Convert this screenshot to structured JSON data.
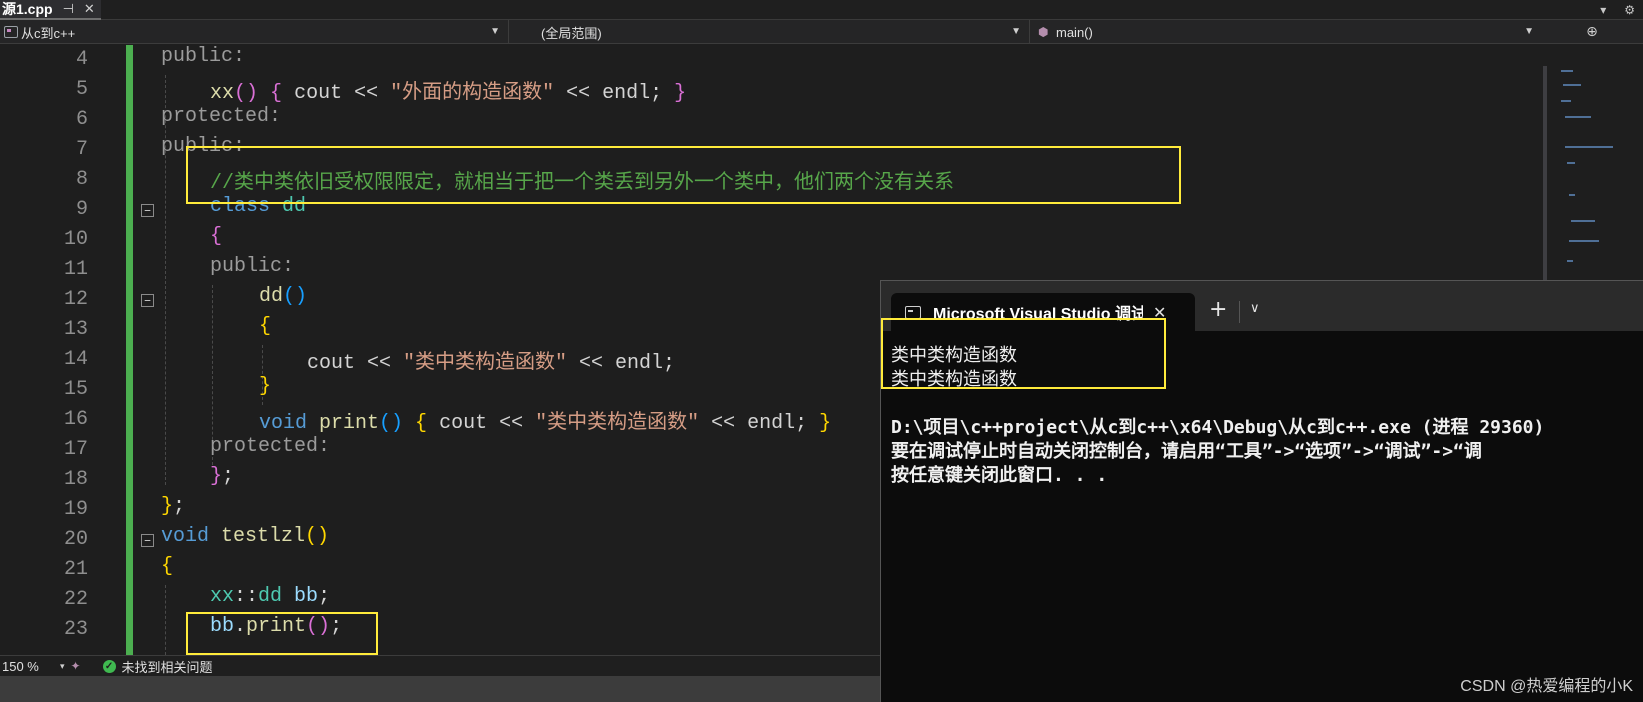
{
  "tab": {
    "title": "源1.cpp",
    "pin_glyph": "⊣",
    "close_glyph": "✕",
    "overflow_glyph": "▾",
    "settings_glyph": "⚙"
  },
  "navbar": {
    "project": "从c到c++",
    "scope": "(全局范围)",
    "member": "main()",
    "split_glyph": "⊕"
  },
  "code": {
    "line_numbers": [
      "4",
      "5",
      "6",
      "7",
      "8",
      "9",
      "10",
      "11",
      "12",
      "13",
      "14",
      "15",
      "16",
      "17",
      "18",
      "19",
      "20",
      "21",
      "22",
      "23"
    ],
    "l4": "public:",
    "l5_fn": "xx",
    "l5_par": "()",
    "l5_ob": "{",
    "l5_a": " cout << ",
    "l5_str": "\"外面的构造函数\"",
    "l5_b": " << endl; ",
    "l5_cb": "}",
    "l6": "protected:",
    "l7": "public:",
    "l8": "//类中类依旧受权限限定，就相当于把一个类丢到另外一个类中，他们两个没有关系",
    "l9_kw": "class",
    "l9_name": " dd",
    "l10": "{",
    "l11": "public:",
    "l12_fn": "dd",
    "l12_par": "()",
    "l13": "{",
    "l14_a": "cout << ",
    "l14_str": "\"类中类构造函数\"",
    "l14_b": " << endl;",
    "l15": "}",
    "l16_kw": "void",
    "l16_fn": " print",
    "l16_par": "()",
    "l16_ob": " {",
    "l16_a": " cout << ",
    "l16_str": "\"类中类构造函数\"",
    "l16_b": " << endl; ",
    "l16_cb": "}",
    "l17": "protected:",
    "l18_br": "}",
    "l18_sc": ";",
    "l19_br": "}",
    "l19_sc": ";",
    "l20_kw": "void",
    "l20_fn": " testlzl",
    "l20_par": "()",
    "l21": "{",
    "l22_ty1": "xx",
    "l22_op": "::",
    "l22_ty2": "dd",
    "l22_var": " bb",
    "l22_sc": ";",
    "l23_var": "bb",
    "l23_dot": ".",
    "l23_fn": "print",
    "l23_par": "()",
    "l23_sc": ";"
  },
  "status": {
    "zoom": "150 %",
    "zoom_arrow": "▾",
    "issues": "未找到相关问题",
    "ok_glyph": "✓"
  },
  "terminal": {
    "tab_title": "Microsoft Visual Studio 调试控制台",
    "close_glyph": "✕",
    "add_glyph": "+",
    "dropdown_glyph": "∨",
    "lines": [
      "类中类构造函数",
      "类中类构造函数",
      "",
      "D:\\项目\\c++project\\从c到c++\\x64\\Debug\\从c到c++.exe (进程 29360)",
      "要在调试停止时自动关闭控制台，请启用“工具”->“选项”->“调试”->“调",
      "按任意键关闭此窗口. . ."
    ]
  },
  "watermark": "CSDN @热爱编程的小K",
  "colors": {
    "change_bar": "#4caf50",
    "highlight": "#ffeb3b",
    "keyword": "#569cd6",
    "comment": "#57a64a",
    "string": "#d69d85"
  }
}
